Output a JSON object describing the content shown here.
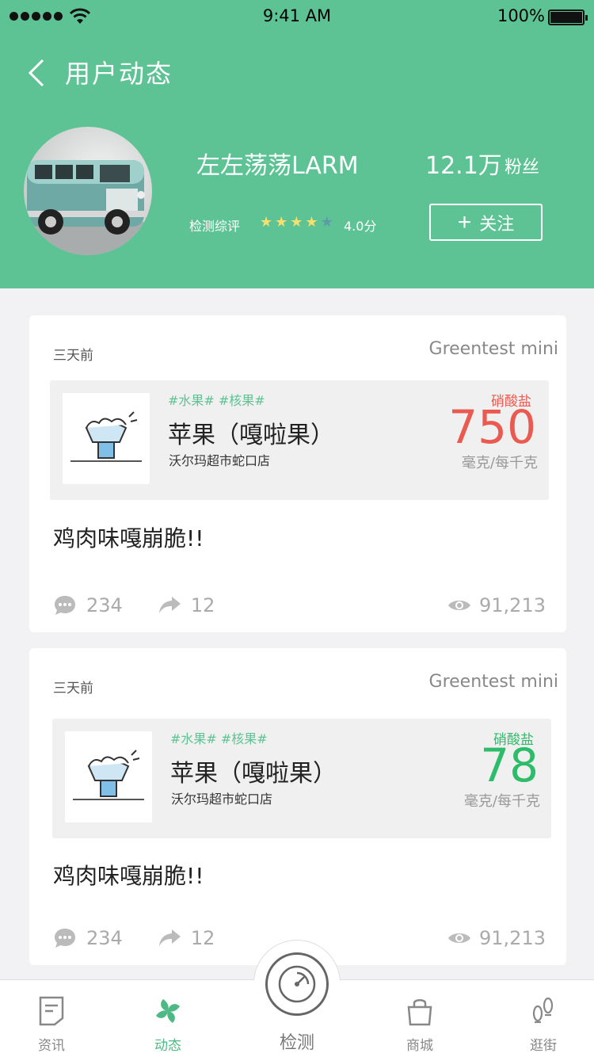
{
  "status": {
    "time": "9:41 AM",
    "battery": "100%"
  },
  "header": {
    "title": "用户动态",
    "username": "左左荡荡LARM",
    "fans_count": "12.1万",
    "fans_label": "粉丝",
    "rating_label": "检测综评",
    "rating_value": 4.0,
    "rating_max": 5,
    "rating_text": "4.0分",
    "follow_label": "关注",
    "bg_color": "#5ec394"
  },
  "posts": [
    {
      "time_ago": "三天前",
      "device": "Greentest mini",
      "tags": "#水果# #核果#",
      "product_name": "苹果（嘎啦果）",
      "store": "沃尔玛超市蛇口店",
      "nitrate_label": "硝酸盐",
      "nitrate_value": "750",
      "unit": "毫克/每千克",
      "level_color": "#ea5a50",
      "text": "鸡肉味嘎崩脆!!",
      "comments": "234",
      "shares": "12",
      "views": "91,213"
    },
    {
      "time_ago": "三天前",
      "device": "Greentest mini",
      "tags": "#水果# #核果#",
      "product_name": "苹果（嘎啦果）",
      "store": "沃尔玛超市蛇口店",
      "nitrate_label": "硝酸盐",
      "nitrate_value": "78",
      "unit": "毫克/每千克",
      "level_color": "#2cbc6a",
      "text": "鸡肉味嘎崩脆!!",
      "comments": "234",
      "shares": "12",
      "views": "91,213"
    }
  ],
  "tabbar": {
    "items": [
      {
        "label": "资讯",
        "icon": "news-icon",
        "active": false
      },
      {
        "label": "动态",
        "icon": "pinwheel-icon",
        "active": true
      },
      {
        "label": "检测",
        "icon": "detector-icon",
        "active": false
      },
      {
        "label": "商城",
        "icon": "shopping-bag-icon",
        "active": false
      },
      {
        "label": "逛街",
        "icon": "footprints-icon",
        "active": false
      }
    ],
    "active_color": "#4fb985"
  }
}
